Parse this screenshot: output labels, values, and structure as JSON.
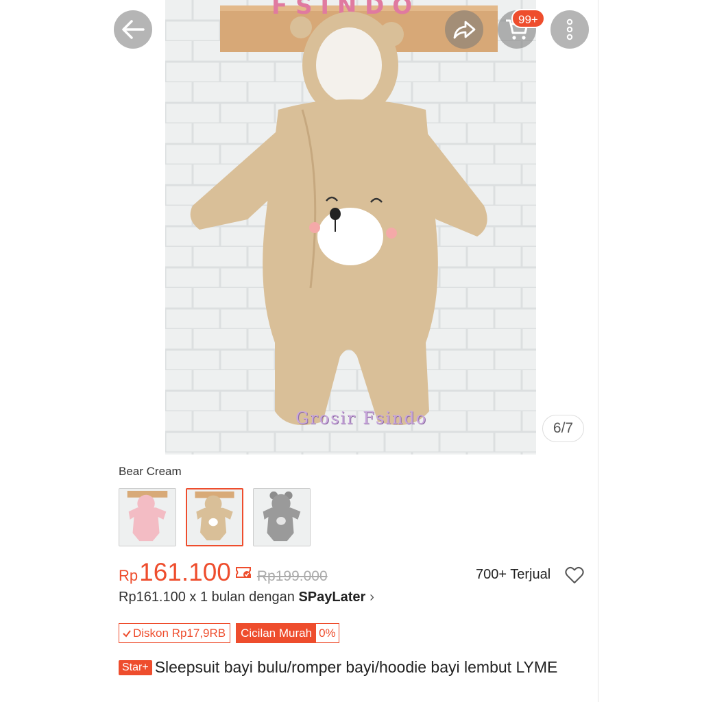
{
  "header": {
    "cart_badge": "99+"
  },
  "hero": {
    "watermark": "Grosir Fsindo",
    "pager": "6/7"
  },
  "variants": {
    "selected_label": "Bear Cream",
    "thumbnails": [
      "pink",
      "cream",
      "grey"
    ],
    "selected_index": 1
  },
  "pricing": {
    "currency": "Rp",
    "price": "161.100",
    "original_price": "Rp199.000",
    "sold": "700+ Terjual",
    "paylater_text": "Rp161.100 x 1 bulan dengan ",
    "paylater_brand": "SPayLater"
  },
  "tags": {
    "discount": "Diskon Rp17,9RB",
    "installment": "Cicilan Murah",
    "installment_rate": "0%"
  },
  "product": {
    "badge": "Star+",
    "title": "Sleepsuit bayi bulu/romper bayi/hoodie bayi lembut LYME"
  },
  "colors": {
    "accent": "#ee4d2d",
    "fur": "#d9bf98"
  }
}
